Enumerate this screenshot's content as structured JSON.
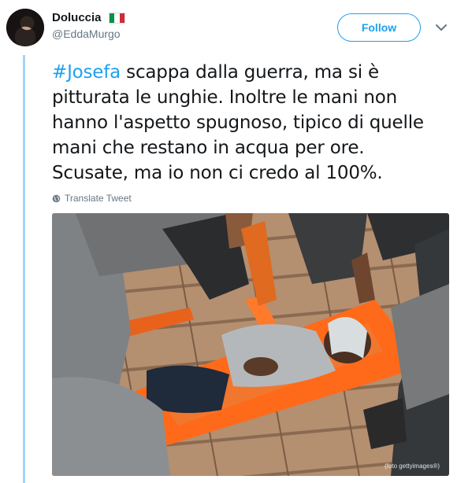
{
  "user": {
    "display_name": "Doluccia",
    "flag": "italy",
    "handle": "@EddaMurgo"
  },
  "follow_label": "Follow",
  "tweet": {
    "hashtag": "#Josefa",
    "text": " scappa dalla guerra, ma si è pitturata le unghie. Inoltre le mani non hanno l'aspetto spugnoso, tipico di quelle mani che restano in acqua per ore. Scusate, ma io non ci credo al 100%."
  },
  "translate_label": "Translate Tweet",
  "media": {
    "credit": "(foto gettyimages®)"
  },
  "colors": {
    "accent": "#1da1f2",
    "thread_line": "#a3d5f7",
    "secondary_text": "#657786"
  }
}
